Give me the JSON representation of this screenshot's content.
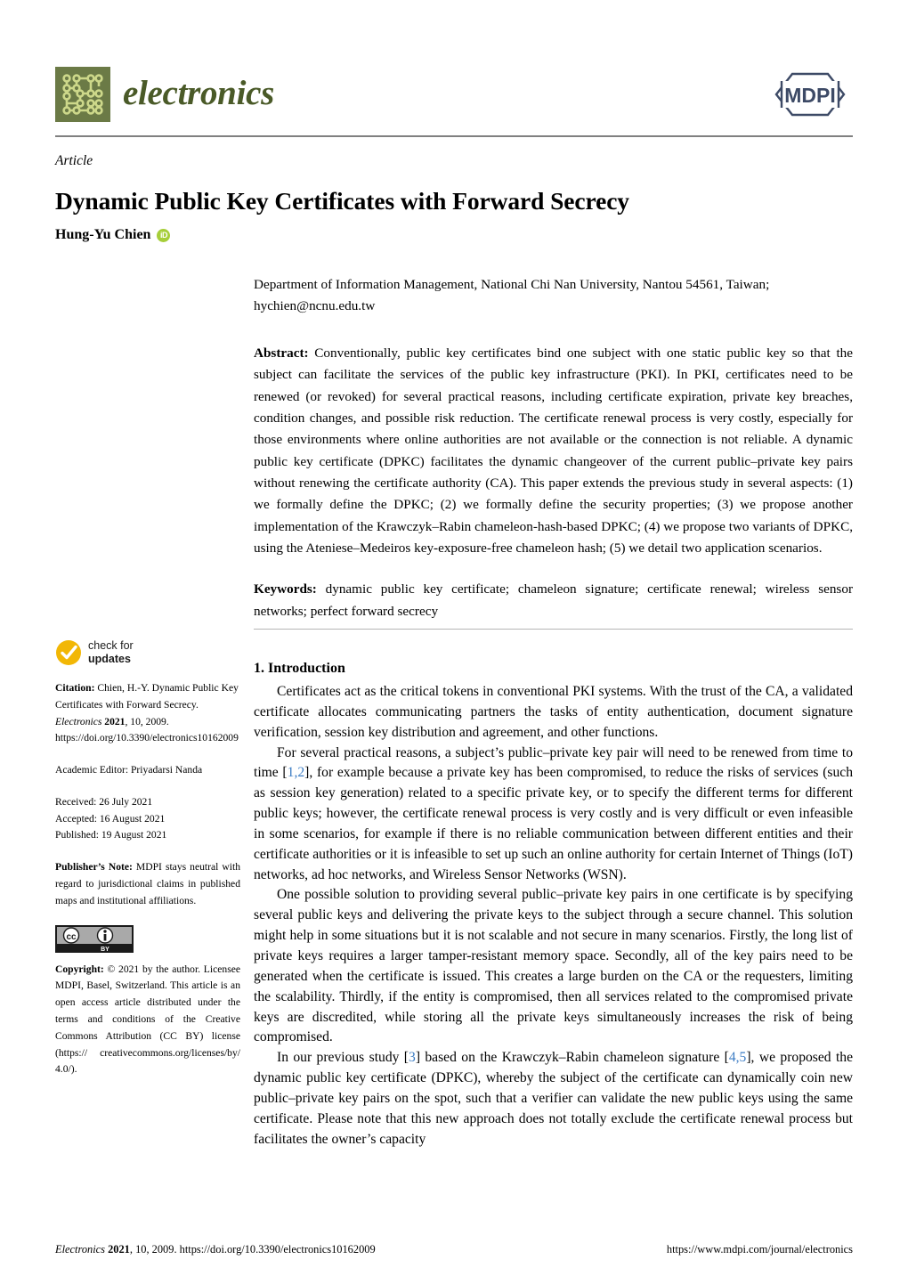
{
  "header": {
    "journal_name": "electronics",
    "publisher_logo_text": "MDPI",
    "journal_mark_color": "#6b7a46",
    "journal_name_color": "#4a5a28",
    "publisher_logo_color": "#3d4a66"
  },
  "title_block": {
    "article_type": "Article",
    "title": "Dynamic Public Key Certificates with Forward Secrecy",
    "author": "Hung-Yu Chien",
    "orcid_icon": "orcid-id-icon",
    "orcid_label": "iD"
  },
  "affiliation": "Department of Information Management, National Chi Nan University, Nantou 54561, Taiwan; hychien@ncnu.edu.tw",
  "abstract": {
    "label": "Abstract:",
    "text": " Conventionally, public key certificates bind one subject with one static public key so that the subject can facilitate the services of the public key infrastructure (PKI). In PKI, certificates need to be renewed (or revoked) for several practical reasons, including certificate expiration, private key breaches, condition changes, and possible risk reduction. The certificate renewal process is very costly, especially for those environments where online authorities are not available or the connection is not reliable. A dynamic public key certificate (DPKC) facilitates the dynamic changeover of the current public–private key pairs without renewing the certificate authority (CA). This paper extends the previous study in several aspects: (1) we formally define the DPKC; (2) we formally define the security properties; (3) we propose another implementation of the Krawczyk–Rabin chameleon-hash-based DPKC; (4) we propose two variants of DPKC, using the Ateniese–Medeiros key-exposure-free chameleon hash; (5) we detail two application scenarios."
  },
  "keywords": {
    "label": "Keywords:",
    "text": " dynamic public key certificate; chameleon signature; certificate renewal; wireless sensor networks; perfect forward secrecy"
  },
  "sidebar": {
    "check_for_updates": {
      "icon": "check-circle-icon",
      "line1": "check for",
      "line2": "updates"
    },
    "citation": {
      "label": "Citation:",
      "text_1": " Chien, H.-Y. Dynamic Public Key Certificates with Forward Secrecy. ",
      "journal": "Electronics",
      "year": "2021",
      "volume_page": ", 10, 2009. https://doi.org/10.3390/electronics10162009"
    },
    "academic_editor": "Academic Editor: Priyadarsi Nanda",
    "dates": {
      "received": "Received: 26 July 2021",
      "accepted": "Accepted: 16 August 2021",
      "published": "Published: 19 August 2021"
    },
    "publishers_note": {
      "label": "Publisher’s Note:",
      "text": " MDPI stays neutral with regard to jurisdictional claims in published maps and institutional affiliations."
    },
    "cc_badge": {
      "icon": "creative-commons-by-icon",
      "cc_label": "cc",
      "by_label": "BY"
    },
    "copyright": {
      "label": "Copyright:",
      "text": " © 2021 by the author. Licensee MDPI, Basel, Switzerland. This article is an open access article distributed under the terms and conditions of the Creative Commons Attribution (CC BY) license (https:// creativecommons.org/licenses/by/ 4.0/)."
    }
  },
  "body": {
    "section_heading": "1. Introduction",
    "paragraphs": [
      {
        "id": "p1",
        "parts": [
          {
            "t": "Certificates act as the critical tokens in conventional PKI systems.  With the trust of the CA, a validated certificate allocates communicating partners the tasks of entity authentication, document signature verification, session key distribution and agreement, and other functions."
          }
        ]
      },
      {
        "id": "p2",
        "parts": [
          {
            "t": "For several practical reasons, a subject’s public–private key pair will need to be renewed from time to time ["
          },
          {
            "t": "1,2",
            "ref": true
          },
          {
            "t": "], for example because a private key has been compromised, to reduce the risks of services (such as session key generation) related to a specific private key, or to specify the different terms for different public keys; however, the certificate renewal process is very costly and is very difficult or even infeasible in some scenarios, for example if there is no reliable communication between different entities and their certificate authorities or it is infeasible to set up such an online authority for certain Internet of Things (IoT) networks, ad hoc networks, and Wireless Sensor Networks (WSN)."
          }
        ]
      },
      {
        "id": "p3",
        "parts": [
          {
            "t": "One possible solution to providing several public–private key pairs in one certificate is by specifying several public keys and delivering the private keys to the subject through a secure channel. This solution might help in some situations but it is not scalable and not secure in many scenarios.  Firstly, the long list of private keys requires a larger tamper-resistant memory space. Secondly, all of the key pairs need to be generated when the certificate is issued. This creates a large burden on the CA or the requesters, limiting the scalability. Thirdly, if the entity is compromised, then all services related to the compromised private keys are discredited, while storing all the private keys simultaneously increases the risk of being compromised."
          }
        ]
      },
      {
        "id": "p4",
        "parts": [
          {
            "t": "In our previous study ["
          },
          {
            "t": "3",
            "ref": true
          },
          {
            "t": "] based on the Krawczyk–Rabin chameleon signature ["
          },
          {
            "t": "4,5",
            "ref": true
          },
          {
            "t": "], we proposed the dynamic public key certificate (DPKC), whereby the subject of the certificate can dynamically coin new public–private key pairs on the spot, such that a verifier can validate the new public keys using the same certificate. Please note that this new approach does not totally exclude the certificate renewal process but facilitates the owner’s capacity"
          }
        ]
      }
    ]
  },
  "footer": {
    "left_journal": "Electronics",
    "left_year": "2021",
    "left_rest": ", 10, 2009. https://doi.org/10.3390/electronics10162009",
    "right": "https://www.mdpi.com/journal/electronics"
  },
  "colors": {
    "reference_link": "#3b7cc4",
    "orcid_green": "#a6ce39",
    "check_yellow": "#f2b705",
    "rule_gray": "#808080"
  }
}
